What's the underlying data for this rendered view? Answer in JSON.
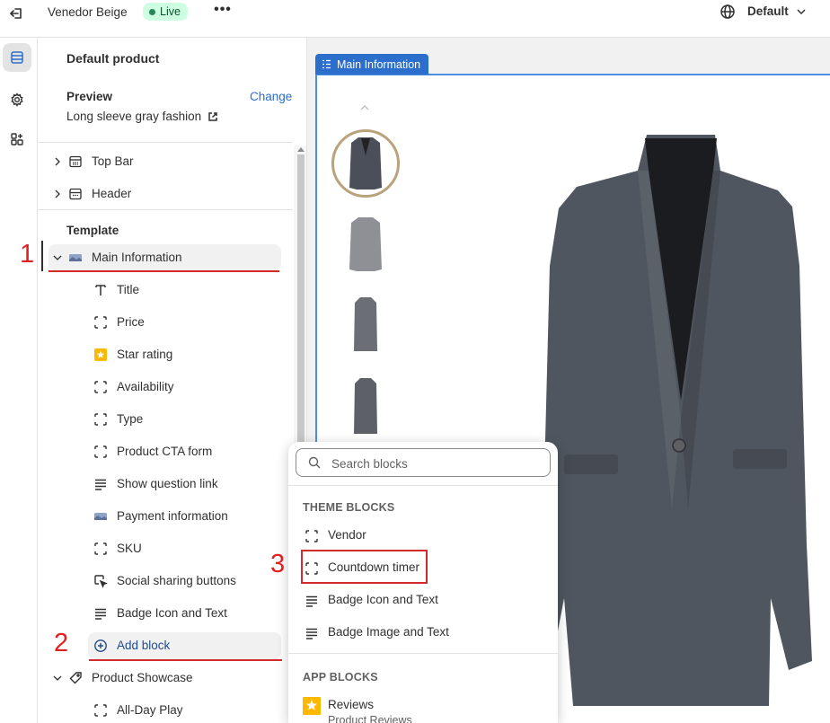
{
  "topbar": {
    "store_name": "Venedor Beige",
    "status": "Live",
    "more_label": "•••",
    "theme": "Default"
  },
  "sidebar": {
    "title": "Default product",
    "preview_label": "Preview",
    "change_label": "Change",
    "preview_product": "Long sleeve gray fashion",
    "top_items": [
      {
        "label": "Top Bar",
        "icon": "layout-top-icon"
      },
      {
        "label": "Header",
        "icon": "layout-header-icon"
      }
    ],
    "template_label": "Template",
    "main_section": {
      "label": "Main Information",
      "icon": "image-thumbnail-icon"
    },
    "blocks": [
      {
        "label": "Title",
        "icon": "text-icon"
      },
      {
        "label": "Price",
        "icon": "dashed-square-icon"
      },
      {
        "label": "Star rating",
        "icon": "star-app-icon"
      },
      {
        "label": "Availability",
        "icon": "dashed-square-icon"
      },
      {
        "label": "Type",
        "icon": "dashed-square-icon"
      },
      {
        "label": "Product CTA form",
        "icon": "dashed-square-icon"
      },
      {
        "label": "Show question link",
        "icon": "text-lines-icon"
      },
      {
        "label": "Payment information",
        "icon": "image-thumbnail-icon"
      },
      {
        "label": "SKU",
        "icon": "dashed-square-icon"
      },
      {
        "label": "Social sharing buttons",
        "icon": "cursor-click-icon"
      },
      {
        "label": "Badge Icon and Text",
        "icon": "text-lines-icon"
      }
    ],
    "add_block_label": "Add block",
    "next_section": {
      "label": "Product Showcase",
      "icon": "tag-icon"
    },
    "next_block": {
      "label": "All-Day Play",
      "icon": "dashed-square-icon"
    }
  },
  "annotations": {
    "step1": "1",
    "step2": "2",
    "step3": "3"
  },
  "preview": {
    "section_tag": "Main Information"
  },
  "popover": {
    "search_placeholder": "Search blocks",
    "theme_blocks_heading": "THEME BLOCKS",
    "theme_blocks": [
      {
        "label": "Vendor",
        "icon": "dashed-square-icon"
      },
      {
        "label": "Countdown timer",
        "icon": "dashed-square-icon"
      },
      {
        "label": "Badge Icon and Text",
        "icon": "text-lines-icon"
      },
      {
        "label": "Badge Image and Text",
        "icon": "text-lines-icon"
      }
    ],
    "app_blocks_heading": "APP BLOCKS",
    "app_blocks": [
      {
        "label": "Reviews",
        "sublabel": "Product Reviews",
        "icon": "star-app-icon"
      }
    ]
  },
  "colors": {
    "accent": "#2c6ecb",
    "annotation_red": "#e21f1f",
    "live_bg": "#cdfee1",
    "star_yellow": "#ffb800"
  }
}
